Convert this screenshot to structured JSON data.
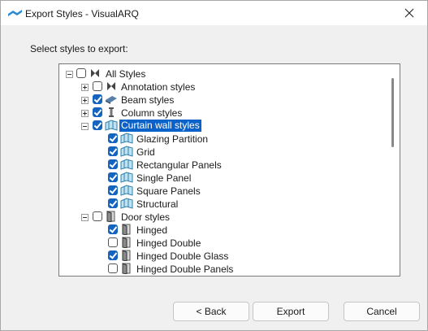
{
  "window": {
    "title": "Export Styles - VisualARQ"
  },
  "prompt": "Select styles to export:",
  "tree": {
    "root": {
      "label": "All Styles",
      "checked": false,
      "expanded": true
    },
    "categories": [
      {
        "label": "Annotation styles",
        "checked": false,
        "expanded": false,
        "icon": "annotation-style-icon"
      },
      {
        "label": "Beam styles",
        "checked": true,
        "expanded": false,
        "icon": "beam-style-icon"
      },
      {
        "label": "Column styles",
        "checked": true,
        "expanded": false,
        "icon": "column-style-icon"
      },
      {
        "label": "Curtain wall styles",
        "checked": true,
        "expanded": true,
        "selected": true,
        "icon": "curtain-wall-style-icon",
        "children": [
          {
            "label": "Glazing Partition",
            "checked": true
          },
          {
            "label": "Grid",
            "checked": true
          },
          {
            "label": "Rectangular Panels",
            "checked": true
          },
          {
            "label": "Single Panel",
            "checked": true
          },
          {
            "label": "Square Panels",
            "checked": true
          },
          {
            "label": "Structural",
            "checked": true
          }
        ]
      },
      {
        "label": "Door styles",
        "checked": false,
        "expanded": true,
        "icon": "door-style-icon",
        "children": [
          {
            "label": "Hinged",
            "checked": true
          },
          {
            "label": "Hinged Double",
            "checked": false
          },
          {
            "label": "Hinged Double Glass",
            "checked": true
          },
          {
            "label": "Hinged Double Panels",
            "checked": false
          }
        ]
      }
    ]
  },
  "buttons": {
    "back": "< Back",
    "export": "Export",
    "cancel": "Cancel"
  },
  "colors": {
    "selection": "#0b62c8",
    "checkbox": "#1565c0"
  }
}
